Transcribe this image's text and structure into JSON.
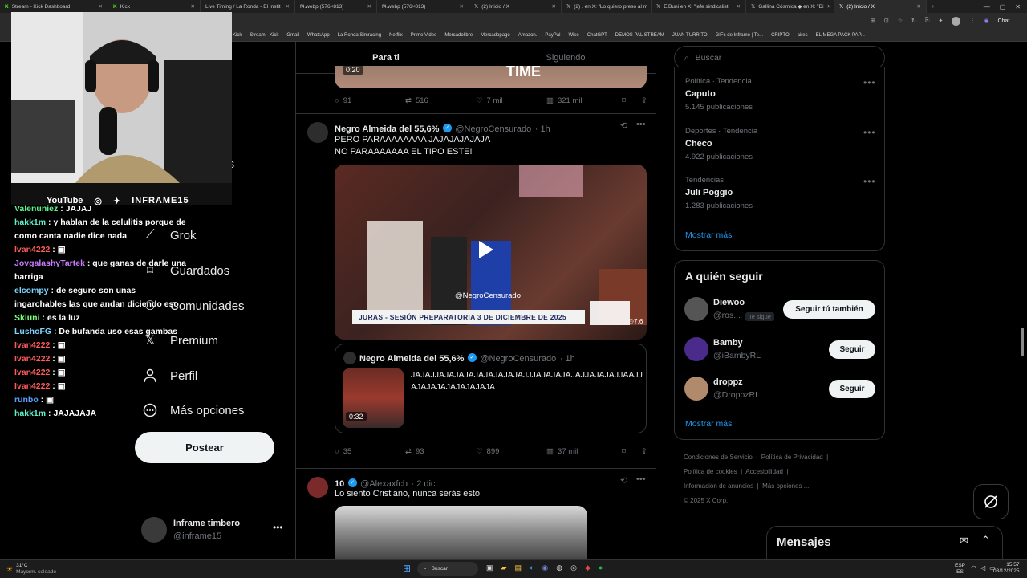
{
  "browser": {
    "tabs": [
      {
        "label": "Stream - Kick Dashboard",
        "active": false
      },
      {
        "label": "Kick",
        "active": false
      },
      {
        "label": "Live Timing / La Ronda - El Instit",
        "active": false
      },
      {
        "label": "f4.webp (576×813)",
        "active": false
      },
      {
        "label": "f4.webp (576×813)",
        "active": false
      },
      {
        "label": "(2) Inicio / X",
        "active": false
      },
      {
        "label": "(2) . en X: \"Lo quiero preso al m",
        "active": false
      },
      {
        "label": "ElBuni en X: \"jefe sindicalist",
        "active": false
      },
      {
        "label": "Gallina Cósmica ◆ en X: \"Di",
        "active": false
      },
      {
        "label": "(2) Inicio / X",
        "active": true
      }
    ],
    "chat_label": "Chat",
    "bookmarks": [
      "Kick",
      "Stream - Kick",
      "Gmail",
      "WhatsApp",
      "La Ronda Simracing",
      "Netflix",
      "Prime Video",
      "Mercadolibre",
      "Mercadopago",
      "Amazon.",
      "PayPal",
      "Wise",
      "ChatGPT",
      "DEMOS PAL STREAM",
      "JUAN TURRITO",
      "GIFs de Inframe | Te...",
      "CRIPTO",
      "aires",
      "EL MEGA PACK PAP..."
    ]
  },
  "stream": {
    "overlay_socials": {
      "youtube": "YouTube",
      "channel": "INFRAME15"
    },
    "chat": [
      {
        "user": "Valenuniez",
        "color": "#5ef08c",
        "text": "JAJAJ"
      },
      {
        "user": "hakk1m",
        "color": "#5ef0c8",
        "text": "y hablan de la celulitis porque de como canta nadie dice nada"
      },
      {
        "user": "Ivan4222",
        "color": "#ff5a5a",
        "text": "▣"
      },
      {
        "user": "JovgalashyTartek",
        "color": "#c77dff",
        "text": "que ganas de darle una barriga"
      },
      {
        "user": "elcompy",
        "color": "#7cd7ff",
        "text": "de seguro son unas ingarchables las que andan diciendo eso"
      },
      {
        "user": "Skiuni",
        "color": "#7cff7c",
        "text": "es la luz"
      },
      {
        "user": "LushoFG",
        "color": "#7cd7ff",
        "text": "De bufanda uso esas gambas"
      },
      {
        "user": "Ivan4222",
        "color": "#ff5a5a",
        "text": "▣"
      },
      {
        "user": "Ivan4222",
        "color": "#ff5a5a",
        "text": "▣"
      },
      {
        "user": "Ivan4222",
        "color": "#ff5a5a",
        "text": "▣"
      },
      {
        "user": "Ivan4222",
        "color": "#ff5a5a",
        "text": "▣"
      },
      {
        "user": "runbo",
        "color": "#5aa0ff",
        "text": "▣"
      },
      {
        "user": "hakk1m",
        "color": "#5ef0c8",
        "text": "JAJAJAJA"
      }
    ]
  },
  "nav": {
    "partial_item": "nes",
    "items": [
      {
        "label": "Grok",
        "icon": "grok-icon"
      },
      {
        "label": "Guardados",
        "icon": "bookmark-icon"
      },
      {
        "label": "Comunidades",
        "icon": "communities-icon"
      },
      {
        "label": "Premium",
        "icon": "x-logo-icon"
      },
      {
        "label": "Perfil",
        "icon": "person-icon"
      },
      {
        "label": "Más opciones",
        "icon": "more-circle-icon"
      }
    ],
    "post_button": "Postear",
    "account": {
      "name": "Inframe timbero",
      "handle": "@inframe15"
    }
  },
  "timeline": {
    "tabs": [
      "Para ti",
      "Siguiendo"
    ],
    "tweet0": {
      "video_time": "0:20",
      "media_caption": "TIME",
      "stats": {
        "replies": "91",
        "reposts": "516",
        "likes": "7 mil",
        "views": "321 mil"
      }
    },
    "tweet1": {
      "name": "Negro Almeida del 55,6%",
      "handle": "@NegroCensurado",
      "time": "· 1h",
      "text_line1": "PERO PARAAAAAAAA JAJAJAJAJAJA",
      "text_line2": "NO PARAAAAAAA EL TIPO ESTE!",
      "video_watermark": "@NegroCensurado",
      "video_banner": "JURAS - SESIÓN PREPARATORIA 3 DE DICIEMBRE DE 2025",
      "video_viewers": "7,6",
      "quote": {
        "name": "Negro Almeida del 55,6%",
        "handle": "@NegroCensurado",
        "time": "· 1h",
        "text": "JAJAJJAJAJAJAJAJAJAJAJAJJJAJAJAJAJAJJAJAJAJJAAJJAJAJAJAJAJAJAJAJA",
        "video_time": "0:32"
      },
      "stats": {
        "replies": "35",
        "reposts": "93",
        "likes": "899",
        "views": "37 mil"
      }
    },
    "tweet2": {
      "name": "10",
      "handle": "@Alexaxfcb",
      "time": "· 2 dic.",
      "text": "Lo siento Cristiano, nunca serás esto"
    }
  },
  "sidebar": {
    "search_placeholder": "Buscar",
    "trends": [
      {
        "category": "Política · Tendencia",
        "name": "Caputo",
        "count": "5.145 publicaciones"
      },
      {
        "category": "Deportes · Tendencia",
        "name": "Checo",
        "count": "4.922 publicaciones"
      },
      {
        "category": "Tendencias",
        "name": "Juli Poggio",
        "count": "1.283 publicaciones"
      }
    ],
    "trends_more": "Mostrar más",
    "who_to_follow_title": "A quién seguir",
    "follow": [
      {
        "name": "Diewoo",
        "handle": "@ros...",
        "badge": "Te sigue",
        "button": "Seguir tú también"
      },
      {
        "name": "Bamby",
        "handle": "@iBambyRL",
        "badge": "",
        "button": "Seguir"
      },
      {
        "name": "droppz",
        "handle": "@DroppzRL",
        "badge": "",
        "button": "Seguir"
      }
    ],
    "follow_more": "Mostrar más",
    "footer_links": [
      "Condiciones de Servicio",
      "Política de Privacidad",
      "Política de cookies",
      "Accesibilidad",
      "Información de anuncios",
      "Más opciones ...",
      "© 2025 X Corp."
    ],
    "messages_title": "Mensajes"
  },
  "taskbar": {
    "weather_temp": "31°C",
    "weather_desc": "Mayorm. soleado",
    "search": "Buscar",
    "lang": "ESP",
    "lang_sub": "ES",
    "time": "15:57",
    "date": "03/12/2025"
  }
}
